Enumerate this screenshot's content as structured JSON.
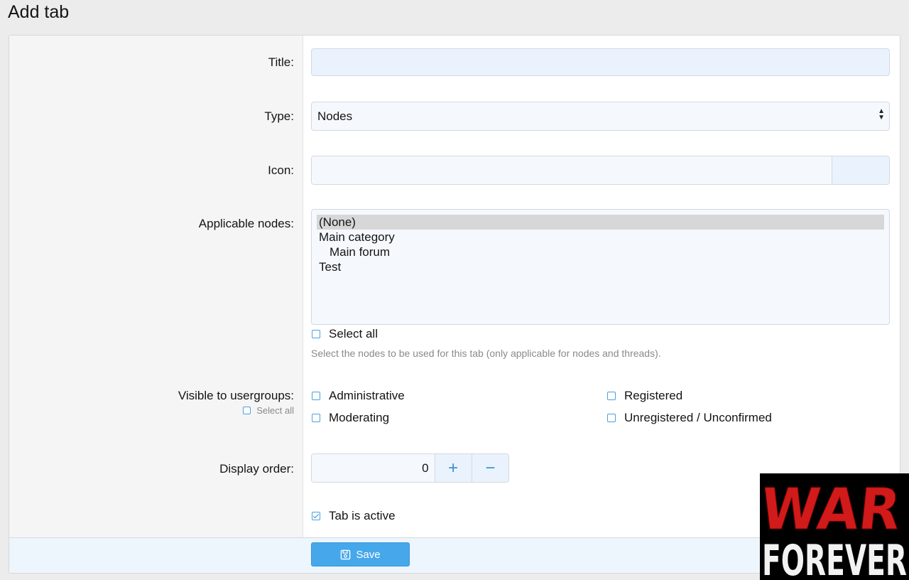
{
  "page": {
    "title": "Add tab"
  },
  "form": {
    "title": {
      "label": "Title:",
      "value": ""
    },
    "type": {
      "label": "Type:",
      "selected": "Nodes"
    },
    "icon": {
      "label": "Icon:",
      "value": ""
    },
    "applicable_nodes": {
      "label": "Applicable nodes:",
      "options": [
        {
          "label": "(None)",
          "selected": true
        },
        {
          "label": "Main category",
          "selected": false
        },
        {
          "label": "Main forum",
          "selected": false
        },
        {
          "label": "Test",
          "selected": false
        }
      ],
      "select_all_label": "Select all",
      "explain": "Select the nodes to be used for this tab (only applicable for nodes and threads)."
    },
    "usergroups": {
      "label": "Visible to usergroups:",
      "select_all_label": "Select all",
      "options": [
        {
          "label": "Administrative",
          "checked": false
        },
        {
          "label": "Registered",
          "checked": false
        },
        {
          "label": "Moderating",
          "checked": false
        },
        {
          "label": "Unregistered / Unconfirmed",
          "checked": false
        }
      ]
    },
    "display_order": {
      "label": "Display order:",
      "value": "0",
      "plus": "+",
      "minus": "−"
    },
    "tab_active": {
      "label": "Tab is active",
      "checked": true
    },
    "save_label": "Save"
  },
  "watermark": {
    "line1": "WAR",
    "line2": "FOREVER"
  },
  "colors": {
    "accent": "#47a7eb",
    "checkbox": "#4aa0e0",
    "watermark_red": "#d11a1a"
  }
}
